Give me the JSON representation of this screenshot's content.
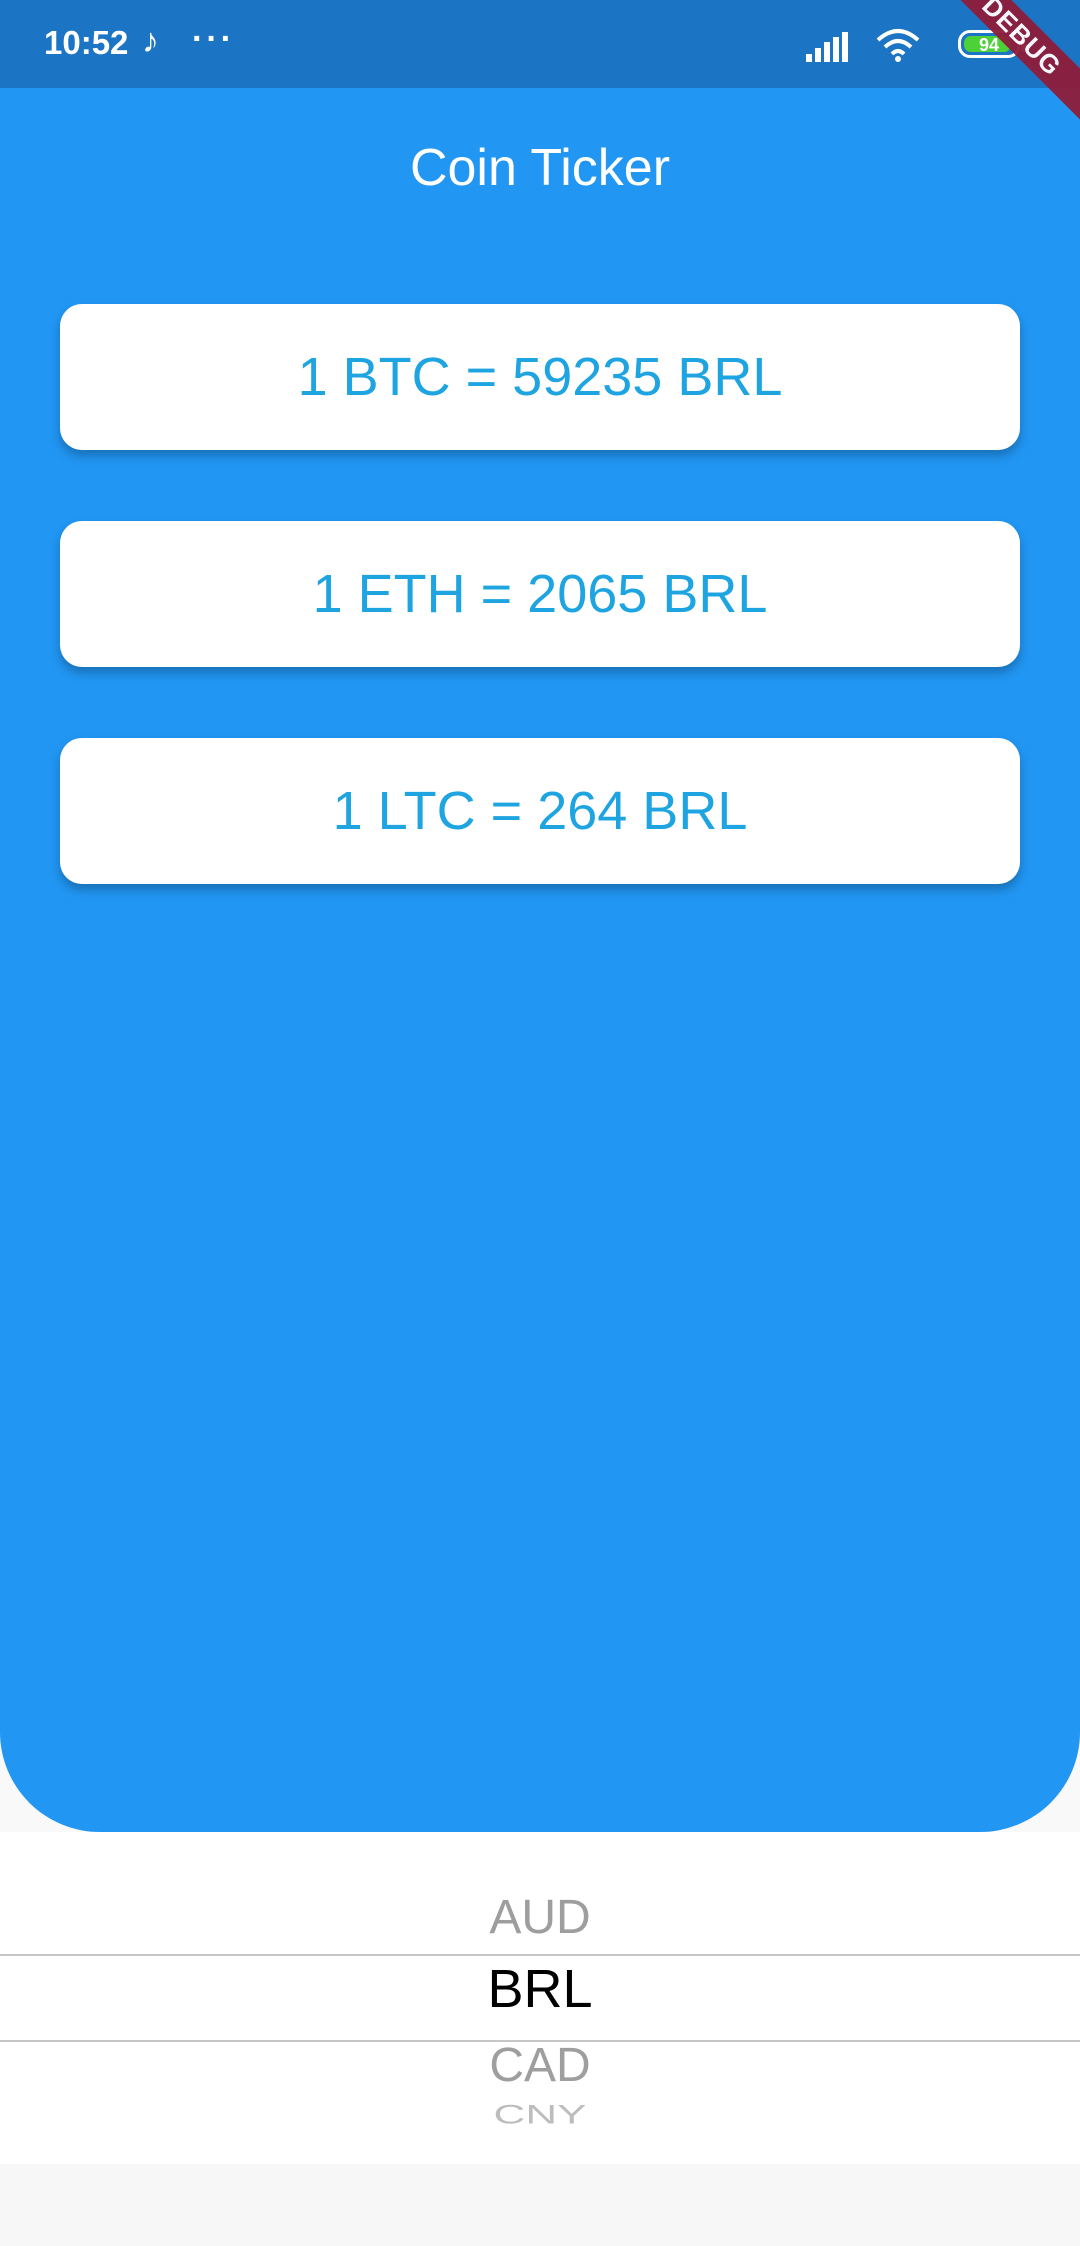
{
  "status_bar": {
    "time": "10:52",
    "dots": "···",
    "battery": "94",
    "battery_level_percent": 94,
    "music_icon": "music-note-icon",
    "signal_icon": "signal-icon",
    "wifi_icon": "wifi-icon"
  },
  "debug_banner": "DEBUG",
  "app": {
    "title": "Coin Ticker",
    "accent_color": "#2196f3",
    "rate_text_color": "#1ea4e0"
  },
  "rates": [
    {
      "text": "1 BTC = 59235 BRL"
    },
    {
      "text": "1 ETH = 2065 BRL"
    },
    {
      "text": "1 LTC = 264 BRL"
    }
  ],
  "picker": {
    "items": [
      "AUD",
      "BRL",
      "CAD",
      "CNY"
    ],
    "selected": "BRL"
  }
}
